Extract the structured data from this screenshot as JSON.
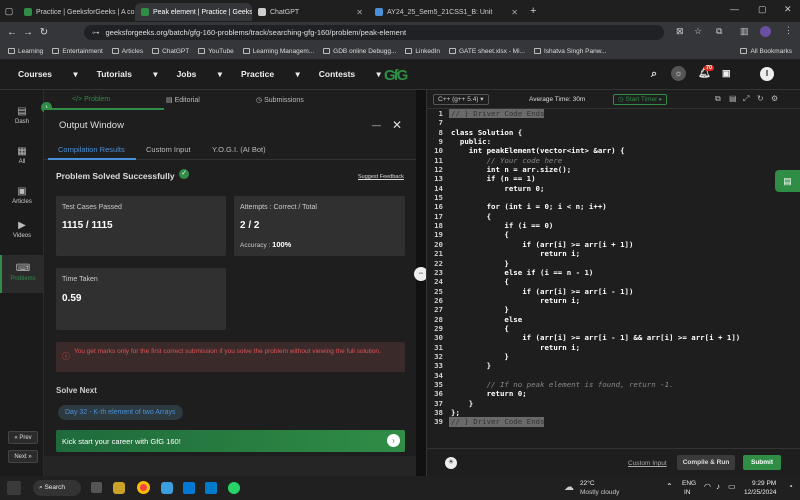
{
  "browser": {
    "tabs": [
      {
        "label": "Practice | GeeksforGeeks | A co",
        "color": "#2f8d46",
        "active": false
      },
      {
        "label": "Peak element | Practice | Geeks",
        "color": "#2f8d46",
        "active": true
      },
      {
        "label": "ChatGPT",
        "color": "#cccccc",
        "active": false
      },
      {
        "label": "AY24_25_Sem5_21CSS1_B: Unit",
        "color": "#4a90d9",
        "active": false
      }
    ],
    "url": "geeksforgeeks.org/batch/gfg-160-problems/track/searching-gfg-160/problem/peak-element",
    "bookmarks": [
      "Learning",
      "Entertainment",
      "Articles",
      "ChatGPT",
      "YouTube",
      "Learning Managem...",
      "GDB online Debugg...",
      "LinkedIn",
      "GATE sheet.xlsx - Mi...",
      "Ishatva Singh Panw..."
    ],
    "all_bookmarks": "All Bookmarks"
  },
  "header": {
    "nav": [
      "Courses",
      "Tutorials",
      "Jobs",
      "Practice",
      "Contests"
    ],
    "logo": "GfG",
    "notif_count": "70",
    "avatar": "I"
  },
  "rail": {
    "items": [
      {
        "label": "Dash",
        "icon": "dashboard-icon",
        "glyph": "▤"
      },
      {
        "label": "All",
        "icon": "grid-icon",
        "glyph": "▦"
      },
      {
        "label": "Articles",
        "icon": "article-icon",
        "glyph": "▣"
      },
      {
        "label": "Videos",
        "icon": "video-icon",
        "glyph": "▶"
      },
      {
        "label": "Problems",
        "icon": "code-icon",
        "glyph": "⌨"
      }
    ],
    "prev": "Prev",
    "next": "Next"
  },
  "panel_tabs": [
    "Problem",
    "Editorial",
    "Submissions"
  ],
  "output": {
    "title": "Output Window",
    "tabs": [
      "Compilation Results",
      "Custom Input",
      "Y.O.G.I. (AI Bot)"
    ],
    "status": "Problem Solved Successfully",
    "suggest": "Suggest Feedback",
    "tests_label": "Test Cases Passed",
    "tests_value": "1115 / 1115",
    "attempts_label": "Attempts : Correct / Total",
    "attempts_value": "2 / 2",
    "accuracy_label": "Accuracy :",
    "accuracy_value": "100%",
    "time_label": "Time Taken",
    "time_value": "0.59",
    "notice": "You get marks only for the first correct submission if you solve the problem without viewing the full solution.",
    "solve_next": "Solve Next",
    "next_problem": "Day 32 - K-th element of two Arrays",
    "banner": "Kick start your career with GfG 160!"
  },
  "editor": {
    "language": "C++ (g++ 5.4)",
    "avg_time": "Average Time: 30m",
    "timer": "Start Timer",
    "custom_input": "Custom Input",
    "compile": "Compile & Run",
    "submit": "Submit",
    "lines": [
      {
        "n": "1",
        "t": "// } Driver Code Ends",
        "hl": true
      },
      {
        "n": "7",
        "t": "",
        "hl": false
      },
      {
        "n": "8",
        "t": "class Solution {",
        "hl": false
      },
      {
        "n": "9",
        "t": "  public:",
        "hl": false
      },
      {
        "n": "10",
        "t": "    int peakElement(vector<int> &arr) {",
        "hl": false
      },
      {
        "n": "11",
        "t": "        // Your code here",
        "hl": false,
        "c": true
      },
      {
        "n": "12",
        "t": "        int n = arr.size();",
        "hl": false
      },
      {
        "n": "13",
        "t": "        if (n == 1)",
        "hl": false
      },
      {
        "n": "14",
        "t": "            return 0;",
        "hl": false
      },
      {
        "n": "15",
        "t": "",
        "hl": false
      },
      {
        "n": "16",
        "t": "        for (int i = 0; i < n; i++)",
        "hl": false
      },
      {
        "n": "17",
        "t": "        {",
        "hl": false
      },
      {
        "n": "18",
        "t": "            if (i == 0)",
        "hl": false
      },
      {
        "n": "19",
        "t": "            {",
        "hl": false
      },
      {
        "n": "20",
        "t": "                if (arr[i] >= arr[i + 1])",
        "hl": false
      },
      {
        "n": "21",
        "t": "                    return i;",
        "hl": false
      },
      {
        "n": "22",
        "t": "            }",
        "hl": false
      },
      {
        "n": "23",
        "t": "            else if (i == n - 1)",
        "hl": false
      },
      {
        "n": "24",
        "t": "            {",
        "hl": false
      },
      {
        "n": "25",
        "t": "                if (arr[i] >= arr[i - 1])",
        "hl": false
      },
      {
        "n": "26",
        "t": "                    return i;",
        "hl": false
      },
      {
        "n": "27",
        "t": "            }",
        "hl": false
      },
      {
        "n": "28",
        "t": "            else",
        "hl": false
      },
      {
        "n": "29",
        "t": "            {",
        "hl": false
      },
      {
        "n": "30",
        "t": "                if (arr[i] >= arr[i - 1] && arr[i] >= arr[i + 1])",
        "hl": false
      },
      {
        "n": "31",
        "t": "                    return i;",
        "hl": false
      },
      {
        "n": "32",
        "t": "            }",
        "hl": false
      },
      {
        "n": "33",
        "t": "        }",
        "hl": false
      },
      {
        "n": "34",
        "t": "",
        "hl": false
      },
      {
        "n": "35",
        "t": "        // If no peak element is found, return -1.",
        "hl": false,
        "c": true
      },
      {
        "n": "36",
        "t": "        return 0;",
        "hl": false
      },
      {
        "n": "37",
        "t": "    }",
        "hl": false
      },
      {
        "n": "38",
        "t": "};",
        "hl": false
      },
      {
        "n": "39",
        "t": "// } Driver Code Ends",
        "hl": true
      }
    ]
  },
  "taskbar": {
    "search": "Search",
    "weather_temp": "22°C",
    "weather_desc": "Mostly cloudy",
    "lang1": "ENG",
    "lang2": "IN",
    "time": "9:29 PM",
    "date": "12/25/2024"
  },
  "colors": {
    "accent": "#2f8d46",
    "error": "#e05252"
  }
}
